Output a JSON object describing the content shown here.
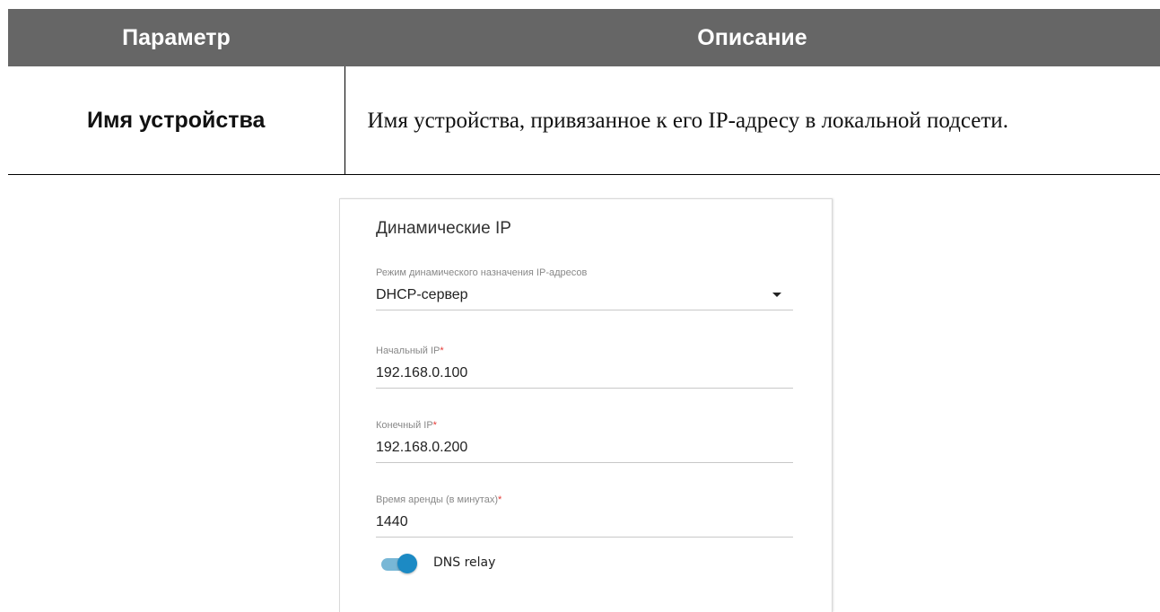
{
  "table": {
    "header_param": "Параметр",
    "header_desc": "Описание",
    "rows": [
      {
        "param": "Имя устройства",
        "desc": "Имя устройства, привязанное к его IP-адресу в локальной подсети."
      }
    ]
  },
  "card": {
    "title": "Динамические IP",
    "mode": {
      "label": "Режим динамического назначения IP-адресов",
      "value": "DHCP-сервер"
    },
    "start_ip": {
      "label": "Начальный IP",
      "required": "*",
      "value": "192.168.0.100"
    },
    "end_ip": {
      "label": "Конечный IP",
      "required": "*",
      "value": "192.168.0.200"
    },
    "lease": {
      "label": "Время аренды (в минутах)",
      "required": "*",
      "value": "1440"
    },
    "dns_relay": {
      "label": "DNS relay",
      "enabled": true
    }
  },
  "colors": {
    "header_bg": "#666666",
    "accent": "#1c8ac4",
    "required": "#e53935"
  }
}
